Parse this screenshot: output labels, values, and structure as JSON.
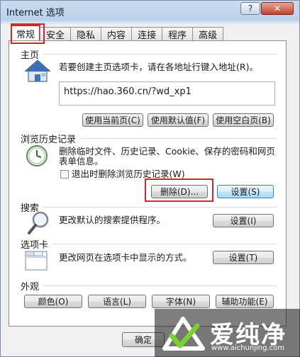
{
  "window": {
    "title": "Internet 选项",
    "help": "?",
    "close": "✕"
  },
  "tabs": [
    "常规",
    "安全",
    "隐私",
    "内容",
    "连接",
    "程序",
    "高级"
  ],
  "home": {
    "group_label": "主页",
    "description": "若要创建主页选项卡，请在各地址行键入地址(R)。",
    "url": "https://hao.360.cn/?wd_xp1",
    "btn_current": "使用当前页(C)",
    "btn_default": "使用默认值(F)",
    "btn_blank": "使用空白页(B)"
  },
  "history": {
    "group_label": "浏览历史记录",
    "description_1": "删除临时文件、历史记录、Cookie、保存的密码和网页",
    "description_2": "表单信息。",
    "checkbox_label": "退出时删除浏览历史记录(W)",
    "btn_delete": "删除(D)...",
    "btn_settings": "设置(S)"
  },
  "search": {
    "group_label": "搜索",
    "description": "更改默认的搜索提供程序。",
    "btn_settings": "设置(I)"
  },
  "tabs_section": {
    "group_label": "选项卡",
    "description": "更改网页在选项卡中显示的方式。",
    "btn_settings": "设置(T)"
  },
  "appearance": {
    "group_label": "外观",
    "btn_colors": "颜色(O)",
    "btn_languages": "语言(L)",
    "btn_fonts": "字体(N)",
    "btn_accessibility": "辅助功能(E)"
  },
  "footer": {
    "ok": "确定"
  },
  "watermark": {
    "text": "爱纯净",
    "url": "www.aichunjing.com"
  }
}
